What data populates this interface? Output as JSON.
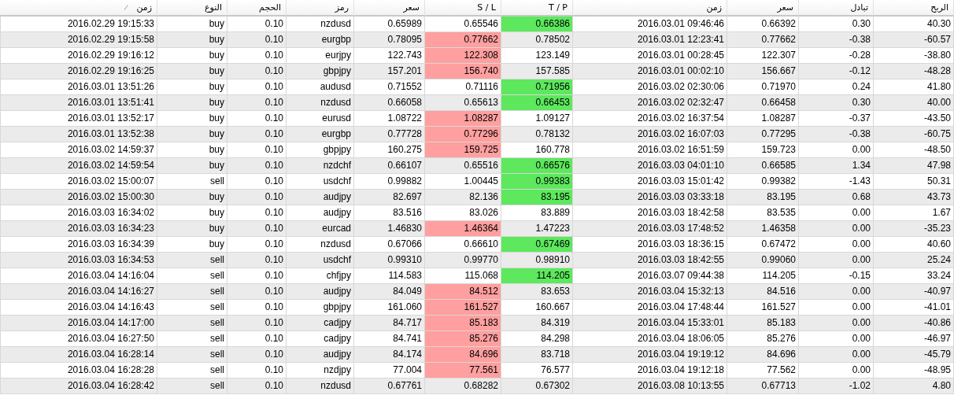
{
  "table": {
    "columns": [
      {
        "label": "زمن",
        "sorted": true
      },
      {
        "label": "النوع",
        "sorted": false
      },
      {
        "label": "الحجم",
        "sorted": false
      },
      {
        "label": "رمز",
        "sorted": false
      },
      {
        "label": "سعر",
        "sorted": false
      },
      {
        "label": "S / L",
        "sorted": false
      },
      {
        "label": "T / P",
        "sorted": false
      },
      {
        "label": "زمن",
        "sorted": false
      },
      {
        "label": "سعر",
        "sorted": false
      },
      {
        "label": "تبادل",
        "sorted": false
      },
      {
        "label": "الربح",
        "sorted": false
      }
    ],
    "rows": [
      {
        "cells": [
          "2016.02.29 19:15:33",
          "buy",
          "0.10",
          "nzdusd",
          "0.65989",
          "0.65546",
          "0.66386",
          "2016.03.01 09:46:46",
          "0.66392",
          "0.30",
          "40.30"
        ],
        "sl_hit": false,
        "tp_hit": true
      },
      {
        "cells": [
          "2016.02.29 19:15:58",
          "buy",
          "0.10",
          "eurgbp",
          "0.78095",
          "0.77662",
          "0.78502",
          "2016.03.01 12:23:41",
          "0.77662",
          "-0.38",
          "-60.57"
        ],
        "sl_hit": true,
        "tp_hit": false
      },
      {
        "cells": [
          "2016.02.29 19:16:12",
          "buy",
          "0.10",
          "eurjpy",
          "122.743",
          "122.308",
          "123.149",
          "2016.03.01 00:28:45",
          "122.307",
          "-0.28",
          "-38.80"
        ],
        "sl_hit": true,
        "tp_hit": false
      },
      {
        "cells": [
          "2016.02.29 19:16:25",
          "buy",
          "0.10",
          "gbpjpy",
          "157.201",
          "156.740",
          "157.585",
          "2016.03.01 00:02:10",
          "156.667",
          "-0.12",
          "-48.28"
        ],
        "sl_hit": true,
        "tp_hit": false
      },
      {
        "cells": [
          "2016.03.01 13:51:26",
          "buy",
          "0.10",
          "audusd",
          "0.71552",
          "0.71116",
          "0.71956",
          "2016.03.02 02:30:06",
          "0.71970",
          "0.24",
          "41.80"
        ],
        "sl_hit": false,
        "tp_hit": true
      },
      {
        "cells": [
          "2016.03.01 13:51:41",
          "buy",
          "0.10",
          "nzdusd",
          "0.66058",
          "0.65613",
          "0.66453",
          "2016.03.02 02:32:47",
          "0.66458",
          "0.30",
          "40.00"
        ],
        "sl_hit": false,
        "tp_hit": true
      },
      {
        "cells": [
          "2016.03.01 13:52:17",
          "buy",
          "0.10",
          "eurusd",
          "1.08722",
          "1.08287",
          "1.09127",
          "2016.03.02 16:37:54",
          "1.08287",
          "-0.37",
          "-43.50"
        ],
        "sl_hit": true,
        "tp_hit": false
      },
      {
        "cells": [
          "2016.03.01 13:52:38",
          "buy",
          "0.10",
          "eurgbp",
          "0.77728",
          "0.77296",
          "0.78132",
          "2016.03.02 16:07:03",
          "0.77295",
          "-0.38",
          "-60.75"
        ],
        "sl_hit": true,
        "tp_hit": false
      },
      {
        "cells": [
          "2016.03.02 14:59:37",
          "buy",
          "0.10",
          "gbpjpy",
          "160.275",
          "159.725",
          "160.778",
          "2016.03.02 16:51:59",
          "159.723",
          "0.00",
          "-48.50"
        ],
        "sl_hit": true,
        "tp_hit": false
      },
      {
        "cells": [
          "2016.03.02 14:59:54",
          "buy",
          "0.10",
          "nzdchf",
          "0.66107",
          "0.65516",
          "0.66576",
          "2016.03.03 04:01:10",
          "0.66585",
          "1.34",
          "47.98"
        ],
        "sl_hit": false,
        "tp_hit": true
      },
      {
        "cells": [
          "2016.03.02 15:00:07",
          "sell",
          "0.10",
          "usdchf",
          "0.99882",
          "1.00445",
          "0.99383",
          "2016.03.03 15:01:42",
          "0.99382",
          "-1.43",
          "50.31"
        ],
        "sl_hit": false,
        "tp_hit": true
      },
      {
        "cells": [
          "2016.03.02 15:00:30",
          "buy",
          "0.10",
          "audjpy",
          "82.697",
          "82.136",
          "83.195",
          "2016.03.03 03:33:18",
          "83.195",
          "0.68",
          "43.73"
        ],
        "sl_hit": false,
        "tp_hit": true
      },
      {
        "cells": [
          "2016.03.03 16:34:02",
          "buy",
          "0.10",
          "audjpy",
          "83.516",
          "83.026",
          "83.889",
          "2016.03.03 18:42:58",
          "83.535",
          "0.00",
          "1.67"
        ],
        "sl_hit": false,
        "tp_hit": false
      },
      {
        "cells": [
          "2016.03.03 16:34:23",
          "buy",
          "0.10",
          "eurcad",
          "1.46830",
          "1.46364",
          "1.47223",
          "2016.03.03 17:48:52",
          "1.46358",
          "0.00",
          "-35.23"
        ],
        "sl_hit": true,
        "tp_hit": false
      },
      {
        "cells": [
          "2016.03.03 16:34:39",
          "buy",
          "0.10",
          "nzdusd",
          "0.67066",
          "0.66610",
          "0.67469",
          "2016.03.03 18:36:15",
          "0.67472",
          "0.00",
          "40.60"
        ],
        "sl_hit": false,
        "tp_hit": true
      },
      {
        "cells": [
          "2016.03.03 16:34:53",
          "sell",
          "0.10",
          "usdchf",
          "0.99310",
          "0.99770",
          "0.98910",
          "2016.03.03 18:42:55",
          "0.99060",
          "0.00",
          "25.24"
        ],
        "sl_hit": false,
        "tp_hit": false
      },
      {
        "cells": [
          "2016.03.04 14:16:04",
          "sell",
          "0.10",
          "chfjpy",
          "114.583",
          "115.068",
          "114.205",
          "2016.03.07 09:44:38",
          "114.205",
          "-0.15",
          "33.24"
        ],
        "sl_hit": false,
        "tp_hit": true
      },
      {
        "cells": [
          "2016.03.04 14:16:27",
          "sell",
          "0.10",
          "audjpy",
          "84.049",
          "84.512",
          "83.653",
          "2016.03.04 15:32:13",
          "84.516",
          "0.00",
          "-40.97"
        ],
        "sl_hit": true,
        "tp_hit": false
      },
      {
        "cells": [
          "2016.03.04 14:16:43",
          "sell",
          "0.10",
          "gbpjpy",
          "161.060",
          "161.527",
          "160.667",
          "2016.03.04 17:48:44",
          "161.527",
          "0.00",
          "-41.01"
        ],
        "sl_hit": true,
        "tp_hit": false
      },
      {
        "cells": [
          "2016.03.04 14:17:00",
          "sell",
          "0.10",
          "cadjpy",
          "84.717",
          "85.183",
          "84.319",
          "2016.03.04 15:33:01",
          "85.183",
          "0.00",
          "-40.86"
        ],
        "sl_hit": true,
        "tp_hit": false
      },
      {
        "cells": [
          "2016.03.04 16:27:50",
          "sell",
          "0.10",
          "cadjpy",
          "84.741",
          "85.276",
          "84.298",
          "2016.03.04 18:06:05",
          "85.276",
          "0.00",
          "-46.97"
        ],
        "sl_hit": true,
        "tp_hit": false
      },
      {
        "cells": [
          "2016.03.04 16:28:14",
          "sell",
          "0.10",
          "audjpy",
          "84.174",
          "84.696",
          "83.718",
          "2016.03.04 19:19:12",
          "84.696",
          "0.00",
          "-45.79"
        ],
        "sl_hit": true,
        "tp_hit": false
      },
      {
        "cells": [
          "2016.03.04 16:28:28",
          "sell",
          "0.10",
          "nzdjpy",
          "77.004",
          "77.561",
          "76.577",
          "2016.03.04 19:12:18",
          "77.562",
          "0.00",
          "-48.95"
        ],
        "sl_hit": true,
        "tp_hit": false
      },
      {
        "cells": [
          "2016.03.04 16:28:42",
          "sell",
          "0.10",
          "nzdusd",
          "0.67761",
          "0.68282",
          "0.67302",
          "2016.03.08 10:13:55",
          "0.67713",
          "-1.02",
          "4.80"
        ],
        "sl_hit": false,
        "tp_hit": false
      }
    ]
  }
}
